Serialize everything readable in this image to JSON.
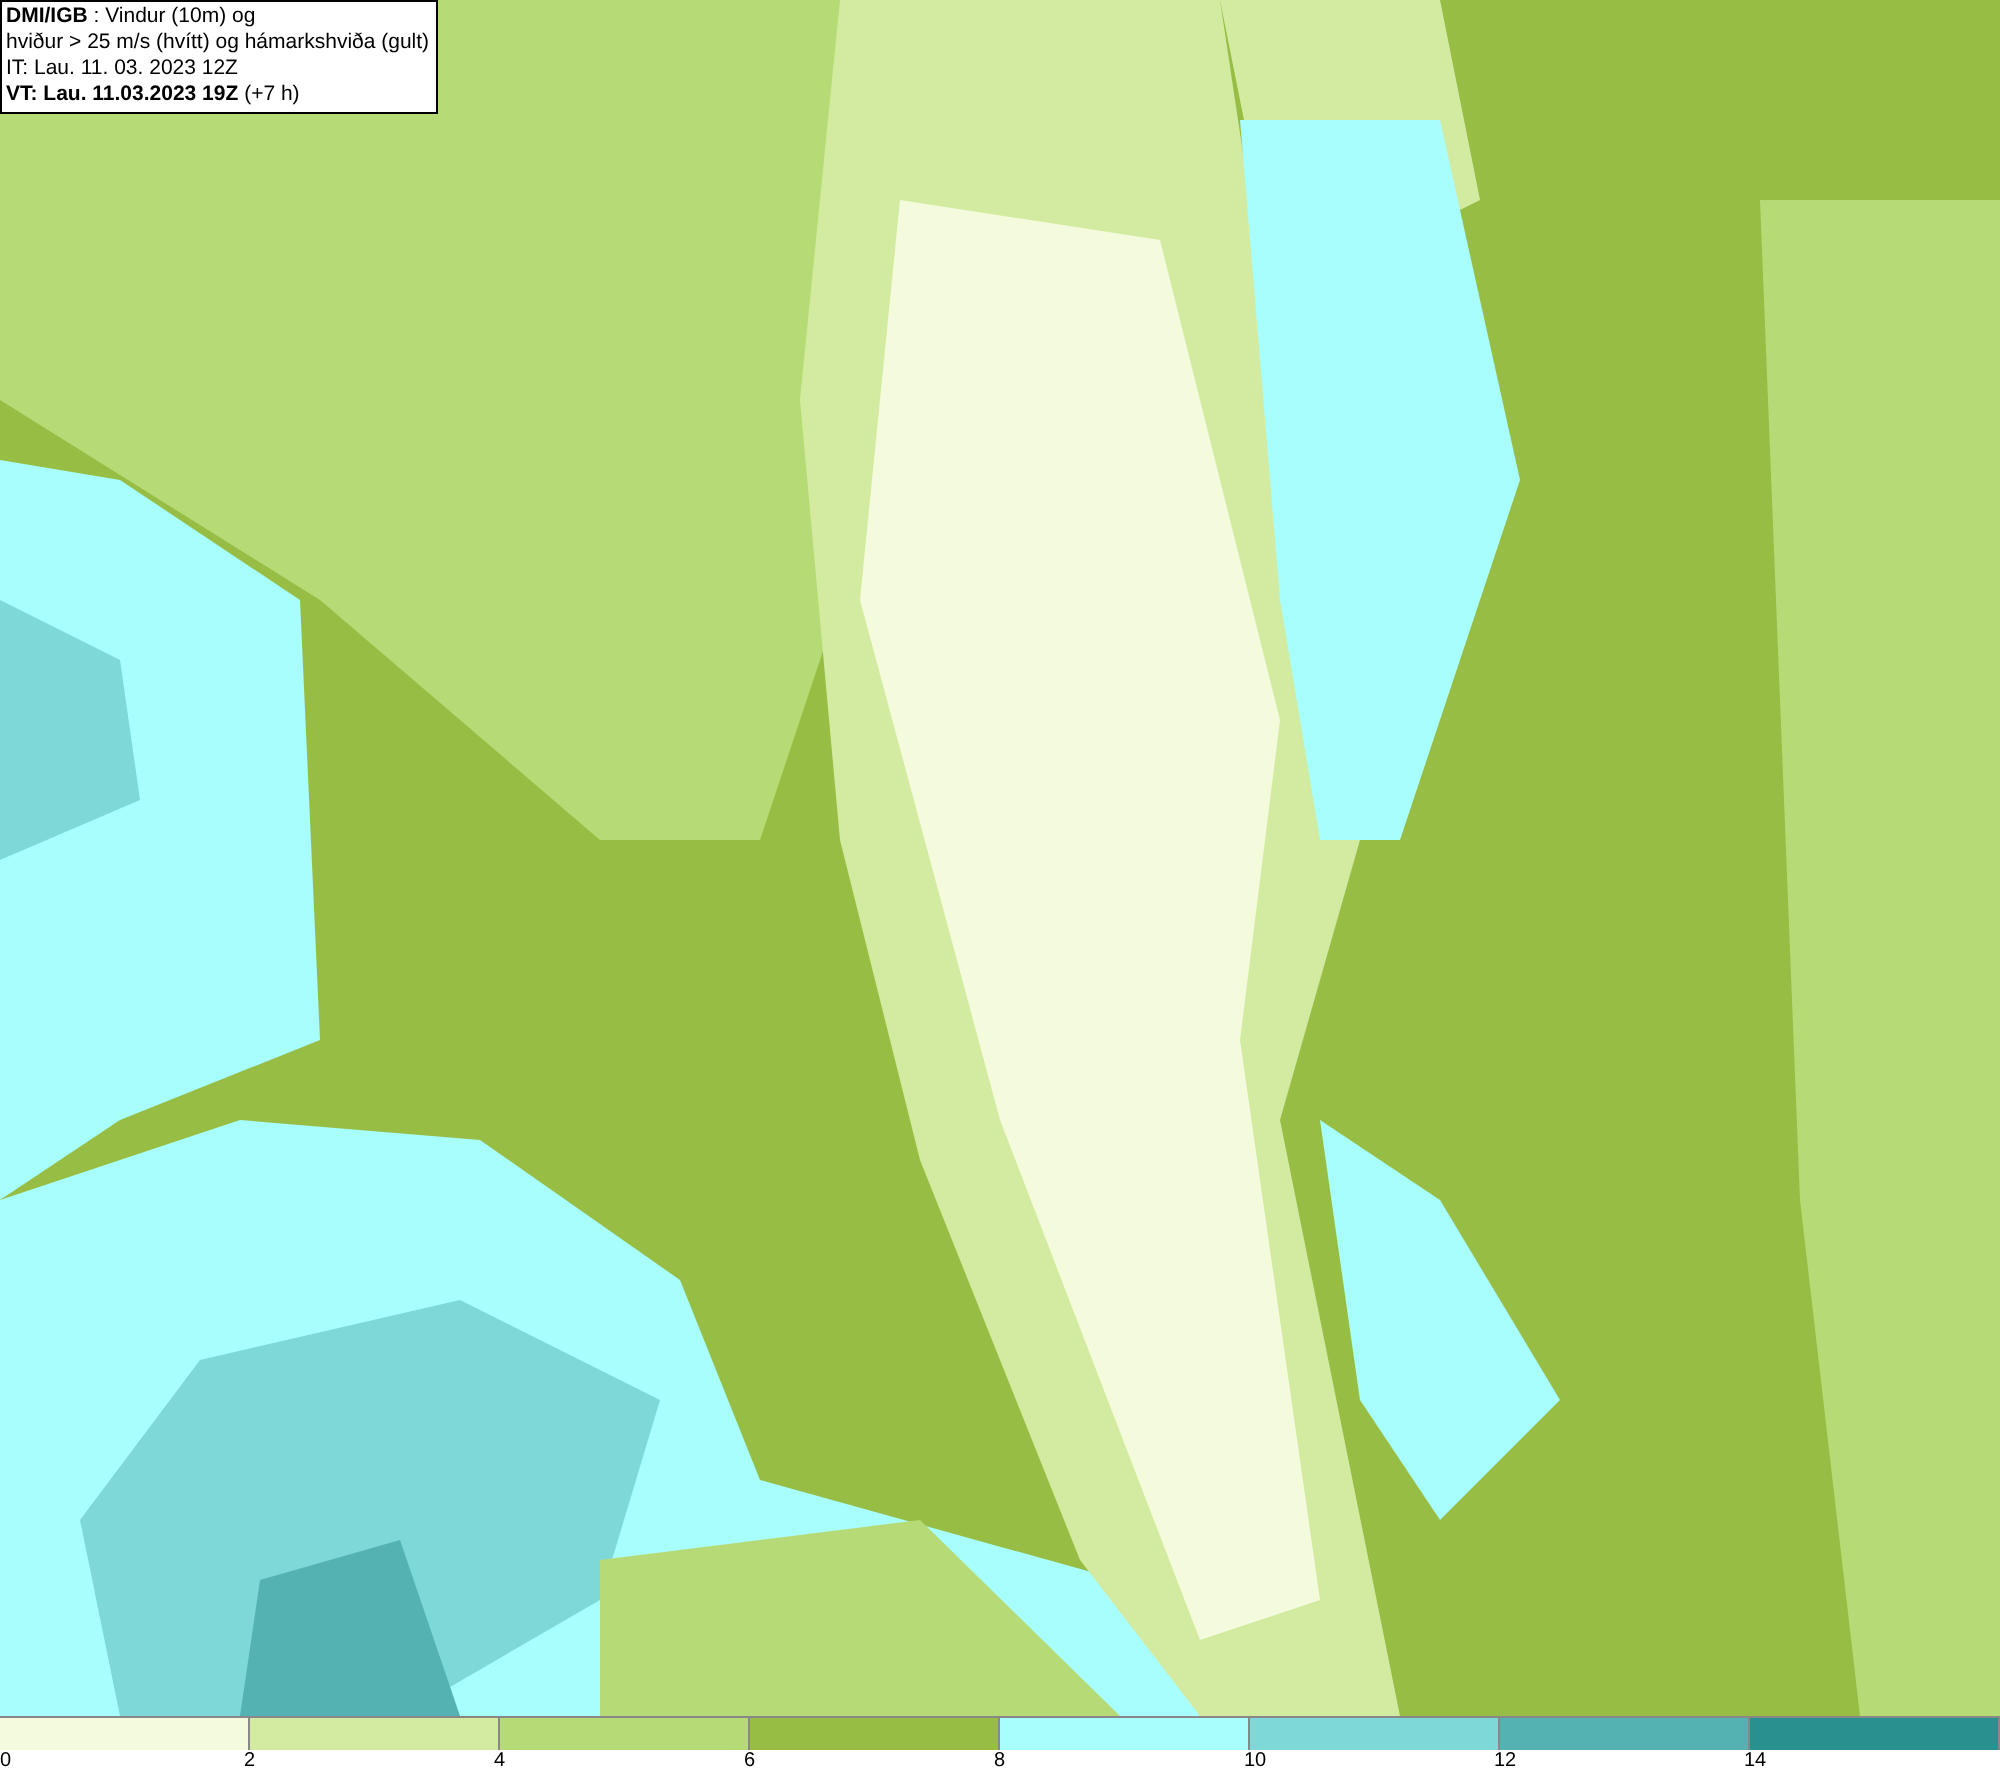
{
  "info_box": {
    "lines": [
      "**DMI/IGB** : Vindur (10m) og",
      "hviður > 25 m/s (hvítt) og hámarkshviða (gult)",
      "IT: Lau. 11. 03. 2023 12Z",
      "**VT: Lau. 11.03.2023 19Z** (+7 h)"
    ]
  },
  "legend": {
    "bands": [
      {
        "color": "#f4fbdc"
      },
      {
        "color": "#d3eba0"
      },
      {
        "color": "#b6db76"
      },
      {
        "color": "#97bd45"
      },
      {
        "color": "#a8fdfd"
      },
      {
        "color": "#7fd8d8"
      },
      {
        "color": "#55b2b2"
      },
      {
        "color": "#2a8f8f"
      }
    ],
    "labels": [
      "0",
      "2",
      "4",
      "6",
      "8",
      "10",
      "12",
      "14"
    ]
  }
}
